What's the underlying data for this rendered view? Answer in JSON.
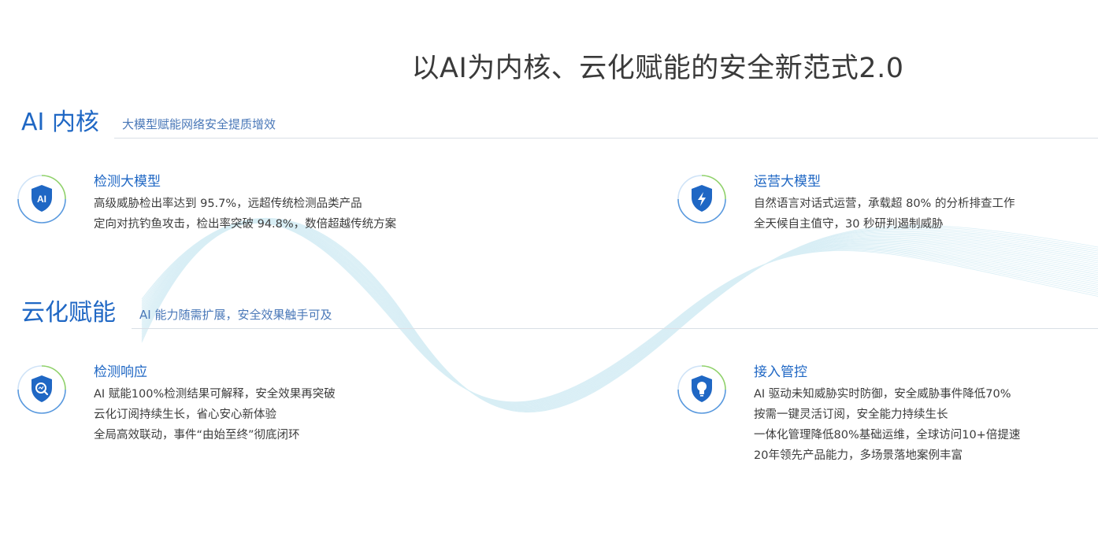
{
  "page": {
    "title": "以AI为内核、云化赋能的安全新范式2.0"
  },
  "colors": {
    "accent": "#1f67c4",
    "subtitle": "#4a78b8",
    "text": "#3c3c3c",
    "rule": "#d9dfe6",
    "icon_ring_green": "#8fd16a",
    "icon_ring_blue": "#2f7fd6"
  },
  "sections": [
    {
      "title": "AI 内核",
      "subtitle": "大模型赋能网络安全提质增效",
      "cards": [
        {
          "icon": "ai-shield-icon",
          "title": "检测大模型",
          "lines": [
            "高级威胁检出率达到 95.7%，远超传统检测品类产品",
            "定向对抗钓鱼攻击，检出率突破 94.8%，数倍超越传统方案"
          ]
        },
        {
          "icon": "lightning-shield-icon",
          "title": "运营大模型",
          "lines": [
            "自然语言对话式运营，承载超 80% 的分析排查工作",
            "全天候自主值守，30 秒研判遏制威胁"
          ]
        }
      ]
    },
    {
      "title": "云化赋能",
      "subtitle": "AI 能力随需扩展，安全效果触手可及",
      "cards": [
        {
          "icon": "search-shield-icon",
          "title": "检测响应",
          "lines": [
            "AI 赋能100%检测结果可解释，安全效果再突破",
            "云化订阅持续生长，省心安心新体验",
            "全局高效联动，事件“由始至终”彻底闭环"
          ]
        },
        {
          "icon": "lightbulb-shield-icon",
          "title": "接入管控",
          "lines": [
            "AI 驱动未知威胁实时防御，安全威胁事件降低70%",
            "按需一键灵活订阅，安全能力持续生长",
            "一体化管理降低80%基础运维，全球访问10+倍提速",
            "20年领先产品能力，多场景落地案例丰富"
          ]
        }
      ]
    }
  ]
}
